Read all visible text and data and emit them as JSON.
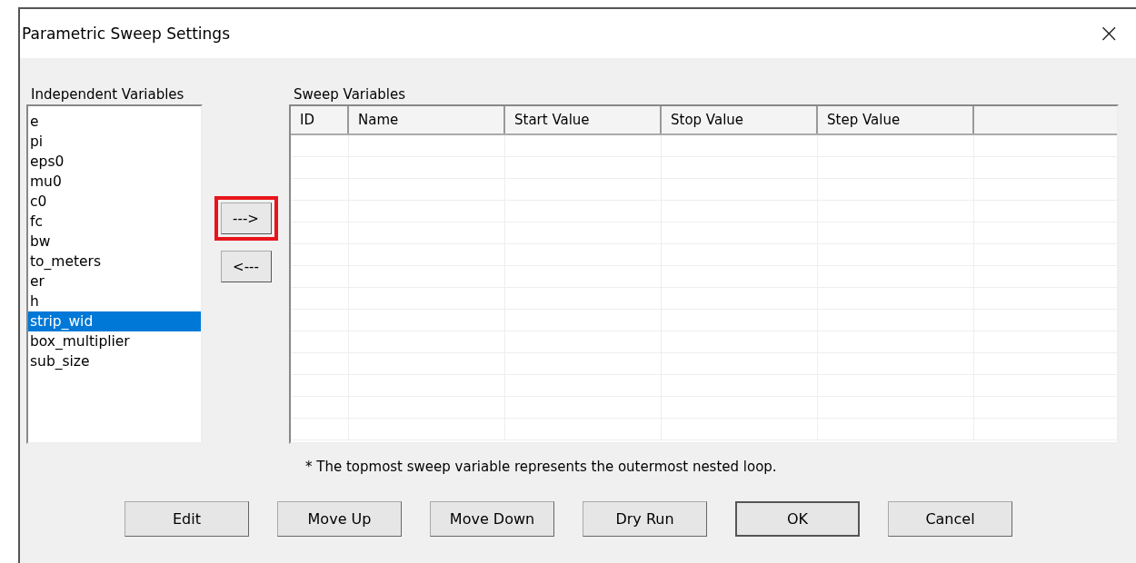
{
  "window": {
    "title": "Parametric Sweep Settings",
    "close": "×"
  },
  "independent_variables": {
    "label": "Independent Variables",
    "items": [
      {
        "name": "e",
        "selected": false
      },
      {
        "name": "pi",
        "selected": false
      },
      {
        "name": "eps0",
        "selected": false
      },
      {
        "name": "mu0",
        "selected": false
      },
      {
        "name": "c0",
        "selected": false
      },
      {
        "name": "fc",
        "selected": false
      },
      {
        "name": "bw",
        "selected": false
      },
      {
        "name": "to_meters",
        "selected": false
      },
      {
        "name": "er",
        "selected": false
      },
      {
        "name": "h",
        "selected": false
      },
      {
        "name": "strip_wid",
        "selected": true
      },
      {
        "name": "box_multiplier",
        "selected": false
      },
      {
        "name": "sub_size",
        "selected": false
      }
    ]
  },
  "transfer_buttons": [
    {
      "label": "--->",
      "highlighted": true
    },
    {
      "label": "<---",
      "highlighted": false
    }
  ],
  "sweep_variables": {
    "label": "Sweep Variables",
    "columns": [
      "ID",
      "Name",
      "Start Value",
      "Stop Value",
      "Step Value"
    ]
  },
  "note": "* The topmost sweep variable represents the outermost nested loop.",
  "buttons": [
    {
      "label": "Edit",
      "default": false
    },
    {
      "label": "Move Up",
      "default": false
    },
    {
      "label": "Move Down",
      "default": false
    },
    {
      "label": "Dry Run",
      "default": false
    },
    {
      "label": "OK",
      "default": true
    },
    {
      "label": "Cancel",
      "default": false
    }
  ]
}
